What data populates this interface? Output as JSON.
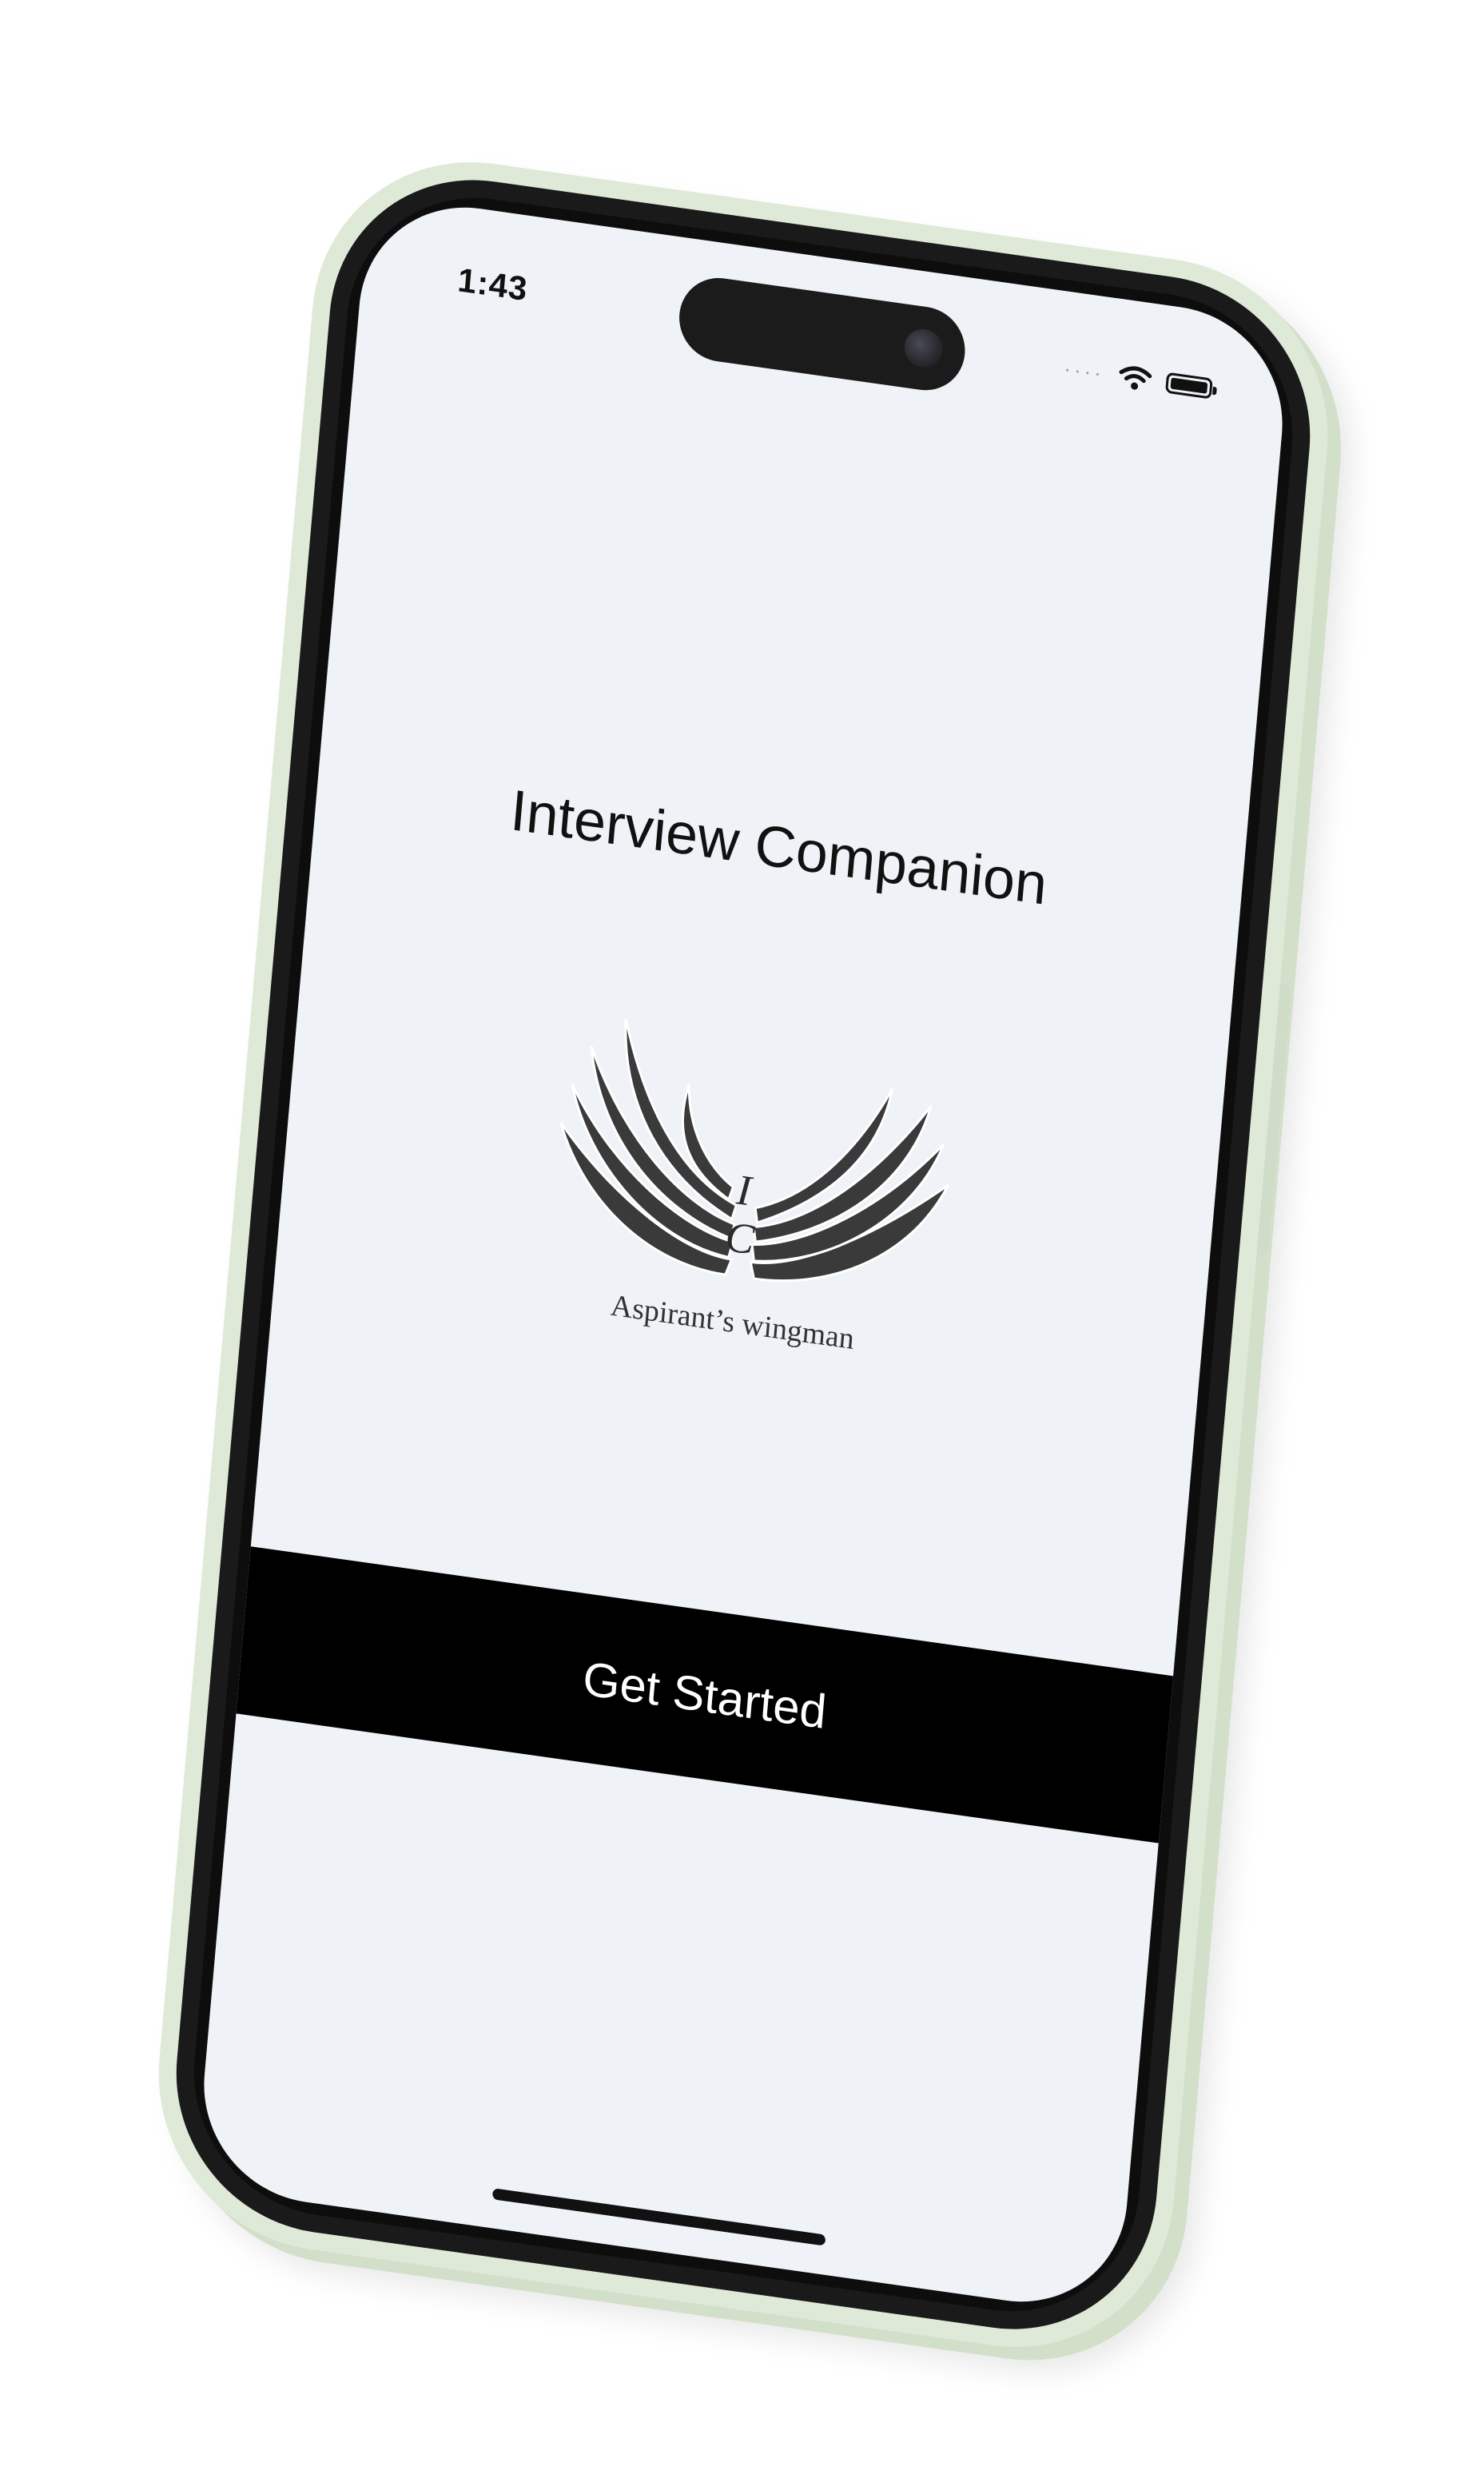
{
  "status_bar": {
    "time": "1:43",
    "icons": [
      "signal-icon",
      "wifi-icon",
      "battery-icon"
    ]
  },
  "app": {
    "title": "Interview Companion",
    "logo": {
      "monogram_top": "I",
      "monogram_bottom": "C",
      "tagline": "Aspirant’s wingman",
      "icon": "wings-logo-icon"
    },
    "primary_action": "Get Started"
  },
  "colors": {
    "screen_background": "#eff2f7",
    "button_background": "#000000",
    "button_text": "#ffffff",
    "case": "#dfe9d8",
    "bezel": "#1a1a1a"
  }
}
